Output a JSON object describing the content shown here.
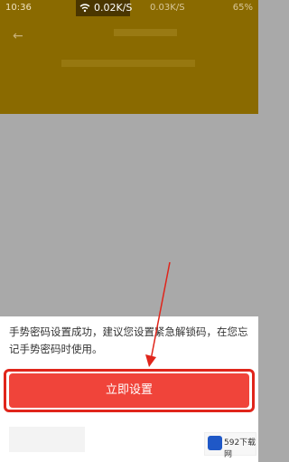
{
  "status_bar": {
    "time": "10:36",
    "network_speed": "0.02K/S",
    "secondary_speed": "0.03K/S",
    "battery": "65%"
  },
  "bottom_sheet": {
    "message": "手势密码设置成功，建议您设置紧急解锁码，在您忘记手势密码时使用。",
    "primary_button": "立即设置"
  },
  "watermark": {
    "text": "592下载网"
  },
  "colors": {
    "header_bg": "#8a6a00",
    "overlay_bg": "#a9a9a9",
    "primary_button": "#f0443a",
    "highlight_outline": "#e0251b",
    "annotation_arrow": "#e0251b"
  }
}
